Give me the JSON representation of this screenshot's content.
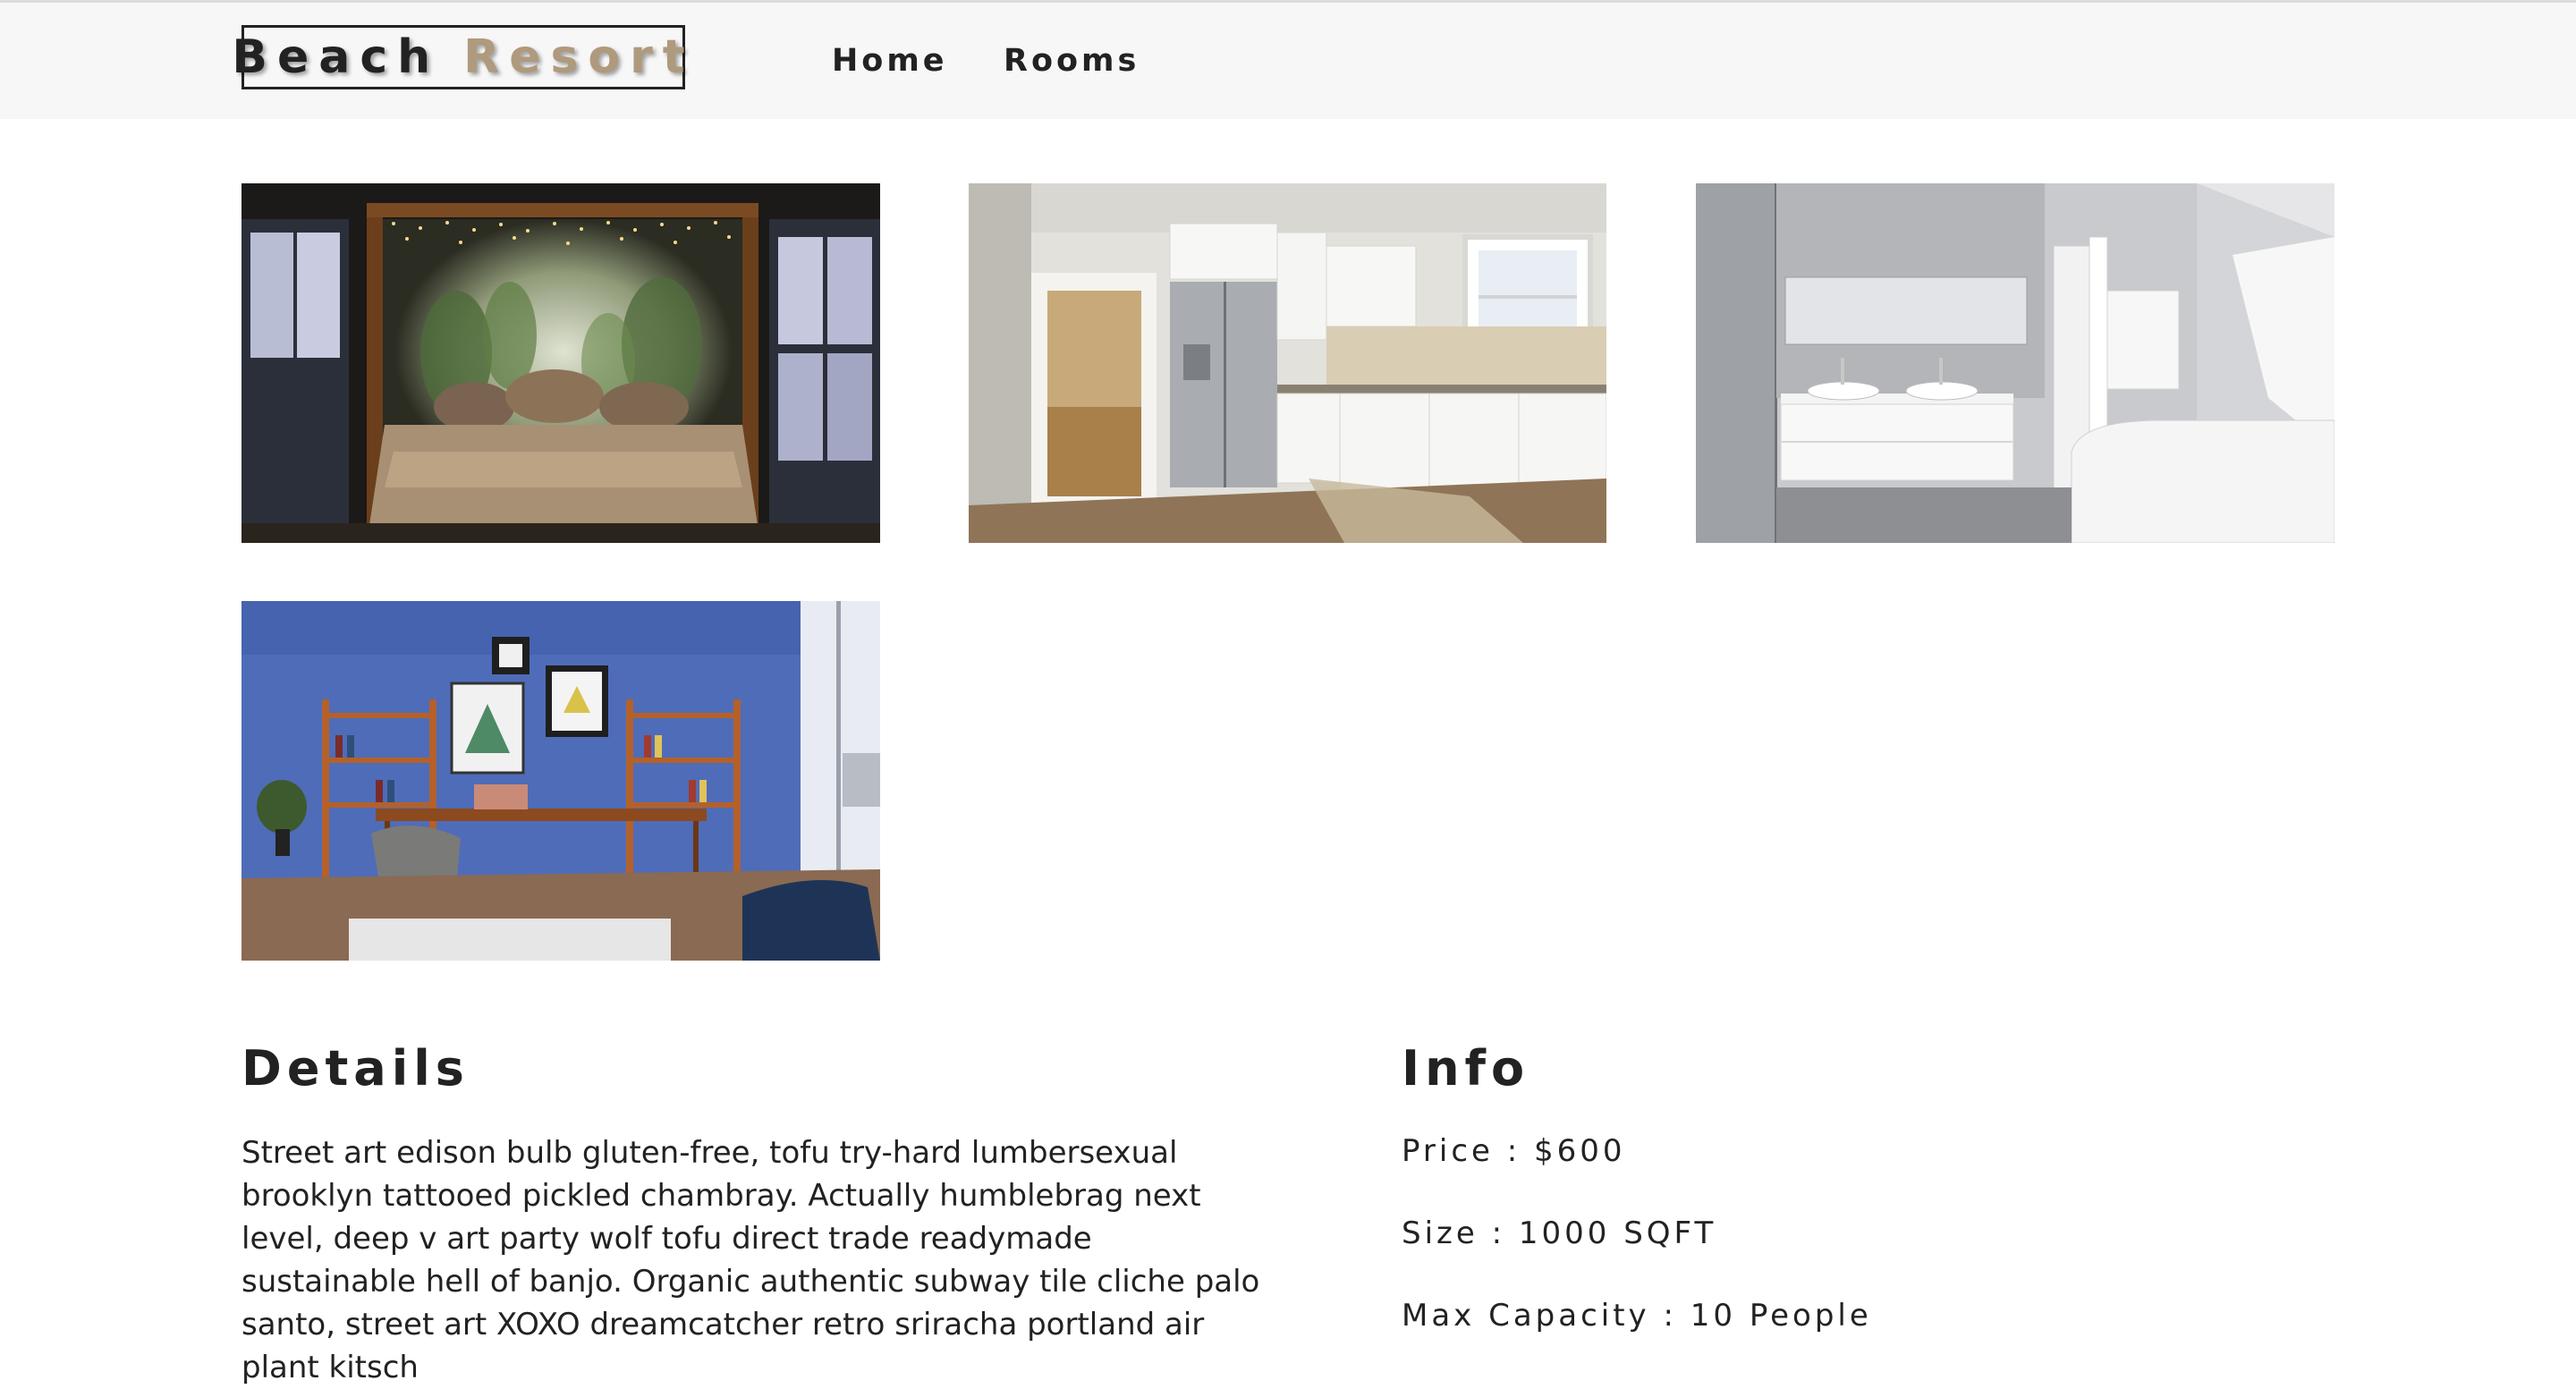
{
  "navbar": {
    "logo_word_1": "Beach",
    "logo_word_2": "Resort",
    "links": [
      {
        "label": "Home"
      },
      {
        "label": "Rooms"
      }
    ]
  },
  "gallery": [
    {
      "subject": "bedroom with canopy bed and string lights"
    },
    {
      "subject": "white kitchen with steel refrigerator"
    },
    {
      "subject": "grey bathroom with double sink and bathtub"
    },
    {
      "subject": "blue study room with desk and bookshelves"
    }
  ],
  "details": {
    "heading": "Details",
    "text": "Street art edison bulb gluten-free, tofu try-hard lumbersexual brooklyn tattooed pickled chambray. Actually humblebrag next level, deep v art party wolf tofu direct trade readymade sustainable hell of banjo. Organic authentic subway tile cliche palo santo, street art XOXO dreamcatcher retro sriracha portland air plant kitsch"
  },
  "info": {
    "heading": "Info",
    "price": "Price : $600",
    "size": "Size : 1000 SQFT",
    "capacity": "Max Capacity : 10 People"
  },
  "colors": {
    "navbar_bg": "#f7f7f7",
    "accent": "#af9a7d",
    "text": "#222222"
  }
}
